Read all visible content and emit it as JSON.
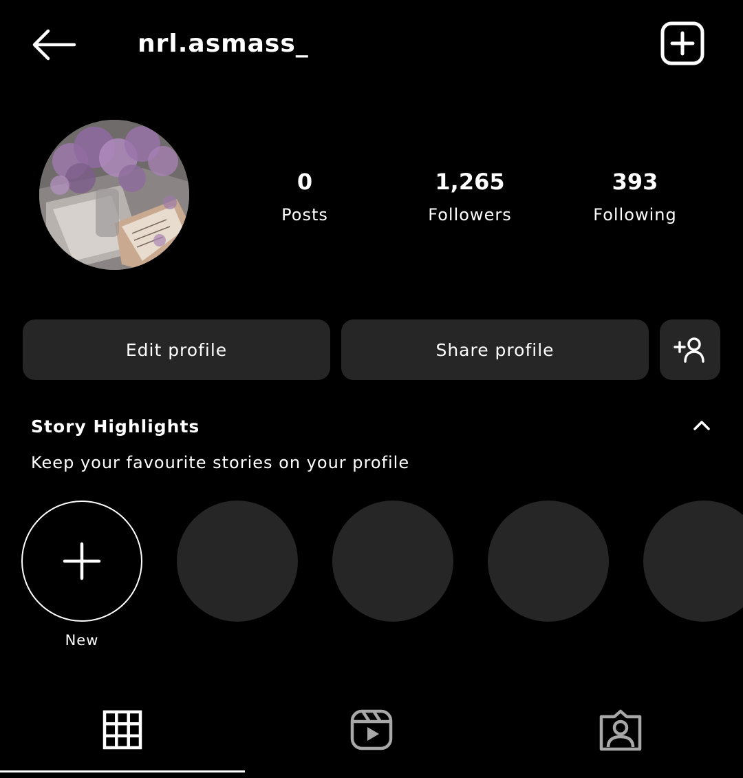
{
  "header": {
    "username": "nrl.asmass_"
  },
  "stats": {
    "posts": {
      "value": "0",
      "label": "Posts"
    },
    "followers": {
      "value": "1,265",
      "label": "Followers"
    },
    "following": {
      "value": "393",
      "label": "Following"
    }
  },
  "actions": {
    "edit_label": "Edit profile",
    "share_label": "Share profile"
  },
  "highlights": {
    "title": "Story Highlights",
    "subtitle": "Keep your favourite stories on your profile",
    "new_label": "New"
  },
  "tabs": [
    {
      "icon": "grid-icon",
      "selected": true
    },
    {
      "icon": "reels-icon",
      "selected": false
    },
    {
      "icon": "tagged-icon",
      "selected": false
    }
  ],
  "colors": {
    "background": "#000000",
    "button": "#262626",
    "text": "#ffffff",
    "inactive_icon": "#a8a8a8"
  }
}
